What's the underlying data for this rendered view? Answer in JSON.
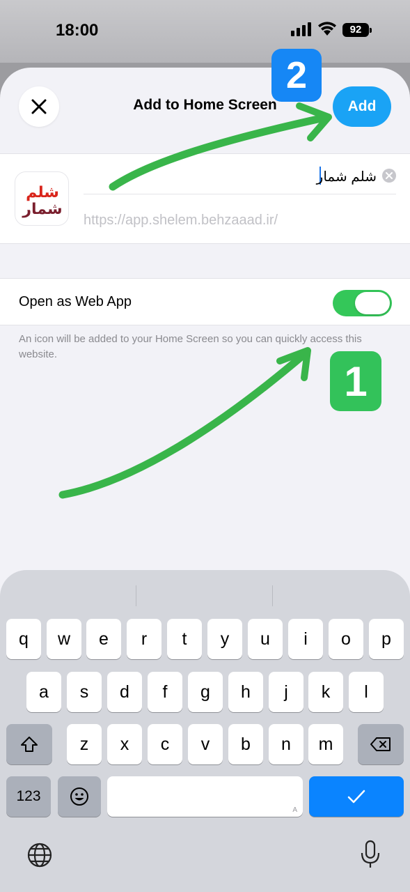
{
  "status_bar": {
    "time": "18:00",
    "battery": "92"
  },
  "sheet": {
    "title": "Add to Home Screen",
    "add_label": "Add",
    "app_name": "شلم شمار",
    "app_icon_text": "شلم شمار",
    "url": "https://app.shelem.behzaaad.ir/",
    "toggle_label": "Open as Web App",
    "toggle_on": true,
    "footnote": "An icon will be added to your Home Screen so you can quickly access this website."
  },
  "annotations": {
    "step_1": "1",
    "step_2": "2",
    "arrow_color": "#39b54a"
  },
  "keyboard": {
    "row1": [
      "q",
      "w",
      "e",
      "r",
      "t",
      "y",
      "u",
      "i",
      "o",
      "p"
    ],
    "row2": [
      "a",
      "s",
      "d",
      "f",
      "g",
      "h",
      "j",
      "k",
      "l"
    ],
    "row3": [
      "z",
      "x",
      "c",
      "v",
      "b",
      "n",
      "m"
    ],
    "numbers_label": "123",
    "space_corner": "A",
    "return_color": "#0a84ff"
  },
  "colors": {
    "accent_blue": "#1aa3f5",
    "toggle_green": "#34c759"
  }
}
